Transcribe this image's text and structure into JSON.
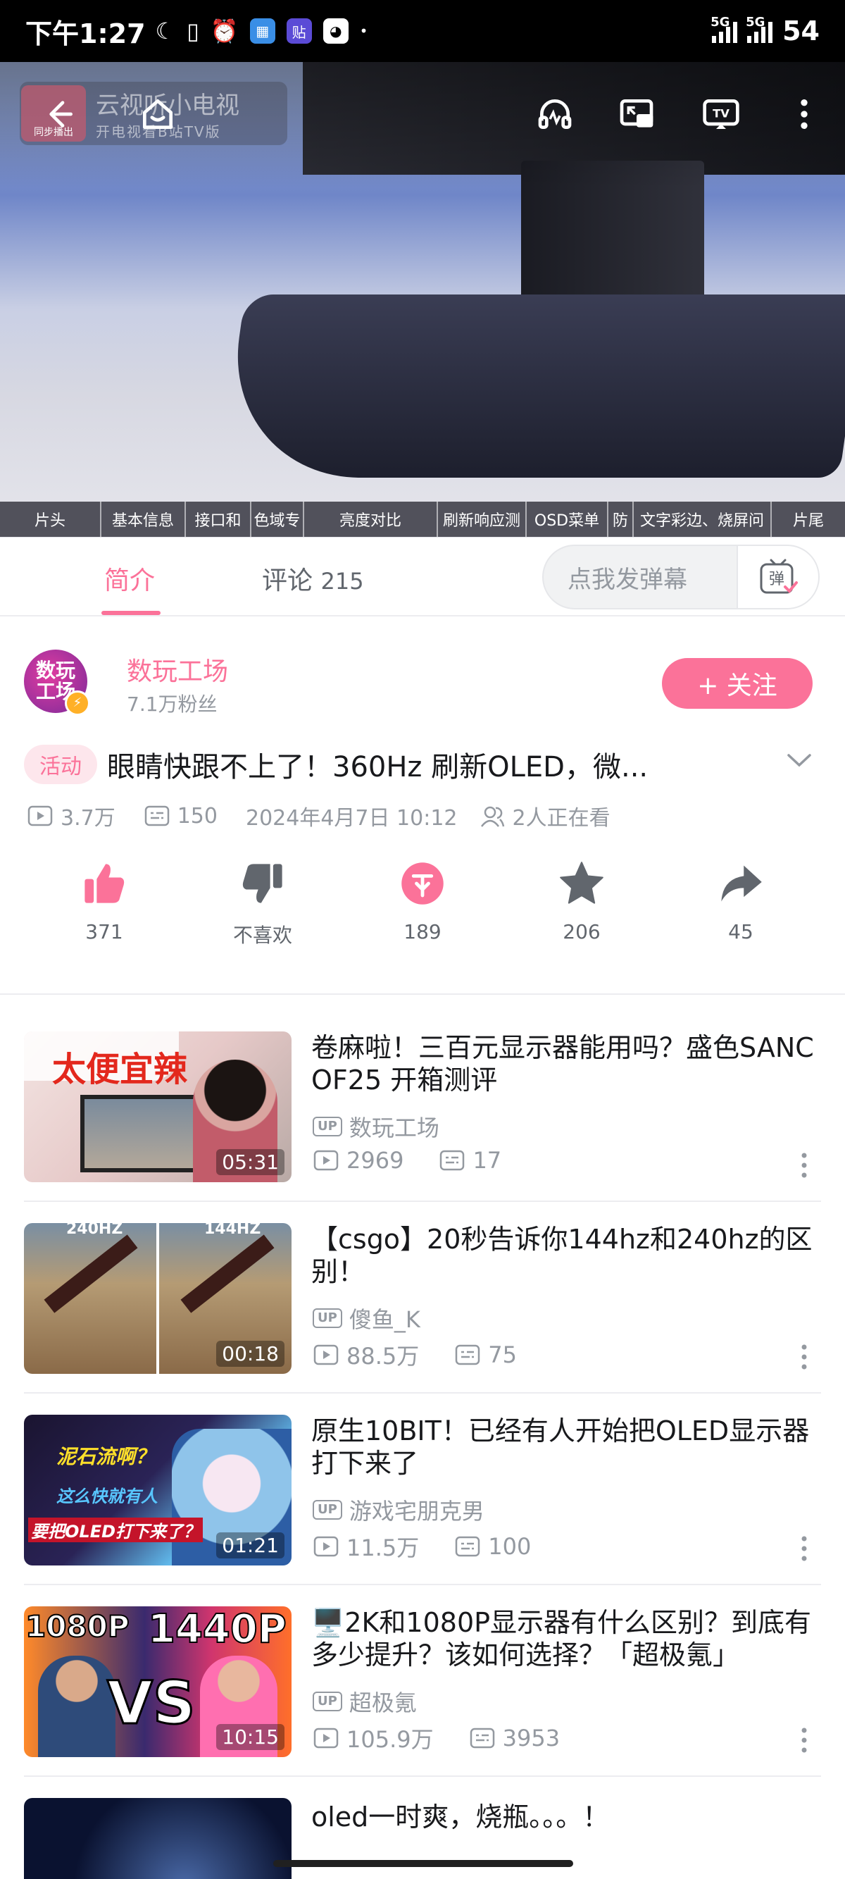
{
  "status_bar": {
    "time": "下午1:27",
    "network_1": "5G",
    "network_2": "5G",
    "battery": "54"
  },
  "video": {
    "overlay_app_name": "云视听小电视",
    "overlay_app_sub": "开电视看B站TV版",
    "overlay_logo_label": "同步播出",
    "chapters": [
      "片头",
      "基本信息",
      "接口和",
      "色域专",
      "亮度对比",
      "刷新响应测",
      "OSD菜单",
      "防",
      "文字彩边、烧屏问",
      "片尾"
    ]
  },
  "tabs": {
    "intro": "简介",
    "comments": "评论",
    "comments_count": "215",
    "danmu_placeholder": "点我发弹幕",
    "danmu_button": "弹"
  },
  "uploader": {
    "avatar_text": "数玩工场",
    "name": "数玩工场",
    "fans": "7.1万粉丝",
    "follow_label": "+ 关注"
  },
  "video_info": {
    "tag": "活动",
    "title": "眼睛快跟不上了！360Hz 刷新OLED，微...",
    "views": "3.7万",
    "danmaku": "150",
    "date": "2024年4月7日 10:12",
    "watching": "2人正在看"
  },
  "actions": {
    "like": "371",
    "dislike": "不喜欢",
    "coin": "189",
    "favorite": "206",
    "share": "45"
  },
  "related": [
    {
      "title": "卷麻啦！三百元显示器能用吗？盛色SANC OF25 开箱测评",
      "up": "数玩工场",
      "views": "2969",
      "danmaku": "17",
      "duration": "05:31",
      "thumb_text": "太便宜辣"
    },
    {
      "title": "【csgo】20秒告诉你144hz和240hz的区别！",
      "up": "傻鱼_K",
      "views": "88.5万",
      "danmaku": "75",
      "duration": "00:18",
      "thumb_text_left": "240HZ",
      "thumb_text_right": "144HZ"
    },
    {
      "title": "原生10BIT！已经有人开始把OLED显示器打下来了",
      "up": "游戏宅朋克男",
      "views": "11.5万",
      "danmaku": "100",
      "duration": "01:21",
      "thumb_text_1": "泥石流啊？",
      "thumb_text_2": "这么快就有人",
      "thumb_text_3": "要把OLED打下来了？"
    },
    {
      "title": "🖥️2K和1080P显示器有什么区别？到底有多少提升？该如何选择？「超极氪」",
      "up": "超极氪",
      "views": "105.9万",
      "danmaku": "3953",
      "duration": "10:15",
      "thumb_text_left": "1080P",
      "thumb_text_right": "1440P",
      "thumb_text_mid": "VS"
    },
    {
      "title": "oled一时爽，烧瓶。。。！"
    }
  ],
  "colors": {
    "accent": "#fb7299",
    "text_primary": "#18191c",
    "text_secondary": "#9499a0"
  }
}
